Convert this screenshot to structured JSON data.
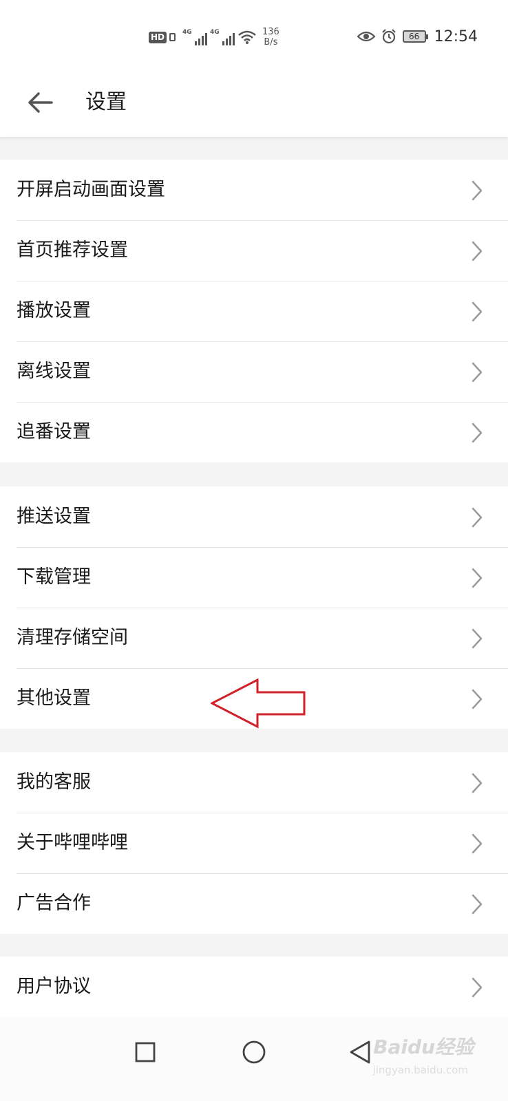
{
  "status_bar": {
    "hd_label": "HD",
    "signal_1": "4G",
    "signal_2": "4G",
    "speed_value": "136",
    "speed_unit": "B/s",
    "battery": "66",
    "time": "12:54"
  },
  "header": {
    "title": "设置"
  },
  "groups": [
    {
      "items": [
        {
          "label": "开屏启动画面设置"
        },
        {
          "label": "首页推荐设置"
        },
        {
          "label": "播放设置"
        },
        {
          "label": "离线设置"
        },
        {
          "label": "追番设置"
        }
      ]
    },
    {
      "items": [
        {
          "label": "推送设置"
        },
        {
          "label": "下载管理"
        },
        {
          "label": "清理存储空间"
        },
        {
          "label": "其他设置"
        }
      ]
    },
    {
      "items": [
        {
          "label": "我的客服"
        },
        {
          "label": "关于哔哩哔哩"
        },
        {
          "label": "广告合作"
        }
      ]
    },
    {
      "items": [
        {
          "label": "用户协议"
        }
      ]
    }
  ],
  "annotation": {
    "color": "#d0202a",
    "points_to": "其他设置"
  },
  "watermark": {
    "text": "Baidu经验",
    "sub": "jingyan.baidu.com"
  },
  "icons": [
    "back-arrow-icon",
    "chevron-right-icon",
    "recent-apps-icon",
    "home-icon",
    "back-triangle-icon",
    "eye-icon",
    "alarm-icon",
    "wifi-icon"
  ]
}
